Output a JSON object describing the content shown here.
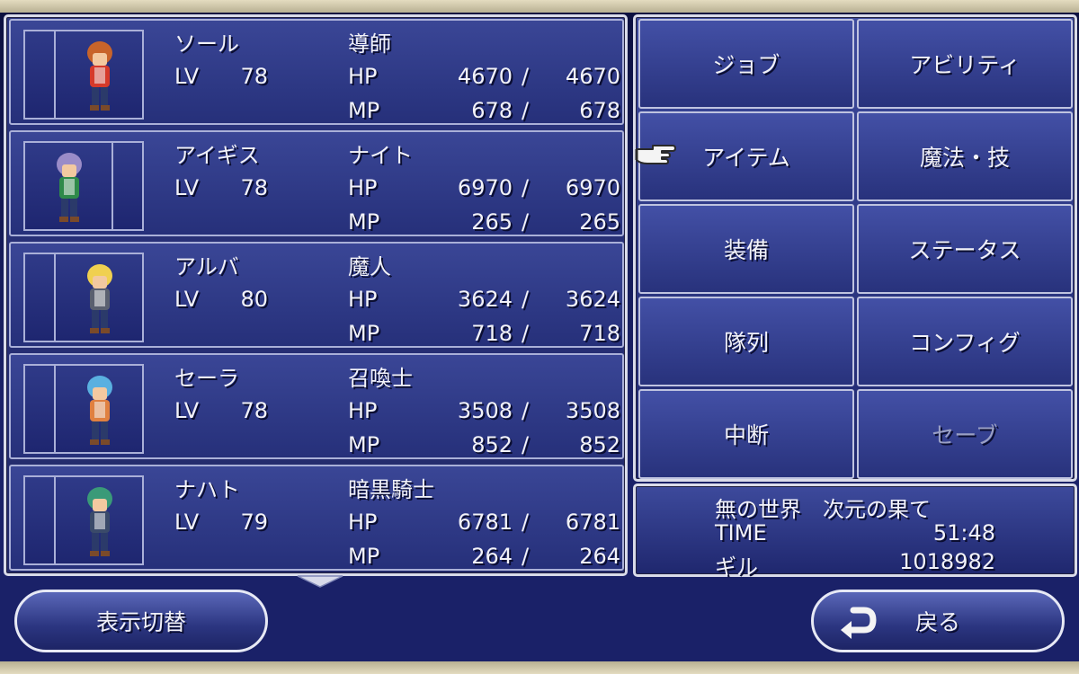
{
  "party": [
    {
      "name": "ソール",
      "job": "導師",
      "lv_label": "LV",
      "lv": "78",
      "hp_label": "HP",
      "hp_cur": "4670",
      "hp_max": "4670",
      "mp_label": "MP",
      "mp_cur": "678",
      "mp_max": "678",
      "hair": "#c8642a",
      "cloth": "#d63a2a"
    },
    {
      "name": "アイギス",
      "job": "ナイト",
      "lv_label": "LV",
      "lv": "78",
      "hp_label": "HP",
      "hp_cur": "6970",
      "hp_max": "6970",
      "mp_label": "MP",
      "mp_cur": "265",
      "mp_max": "265",
      "hair": "#9a8cc8",
      "cloth": "#2f8a4a"
    },
    {
      "name": "アルバ",
      "job": "魔人",
      "lv_label": "LV",
      "lv": "80",
      "hp_label": "HP",
      "hp_cur": "3624",
      "hp_max": "3624",
      "mp_label": "MP",
      "mp_cur": "718",
      "mp_max": "718",
      "hair": "#f0d050",
      "cloth": "#5a6070"
    },
    {
      "name": "セーラ",
      "job": "召喚士",
      "lv_label": "LV",
      "lv": "78",
      "hp_label": "HP",
      "hp_cur": "3508",
      "hp_max": "3508",
      "mp_label": "MP",
      "mp_cur": "852",
      "mp_max": "852",
      "hair": "#5ab0e0",
      "cloth": "#e08040"
    },
    {
      "name": "ナハト",
      "job": "暗黒騎士",
      "lv_label": "LV",
      "lv": "79",
      "hp_label": "HP",
      "hp_cur": "6781",
      "hp_max": "6781",
      "mp_label": "MP",
      "mp_cur": "264",
      "mp_max": "264",
      "hair": "#3a9a78",
      "cloth": "#3a4a6a"
    }
  ],
  "slash": "/",
  "menu": {
    "job": "ジョブ",
    "ability": "アビリティ",
    "item": "アイテム",
    "magic": "魔法・技",
    "equip": "装備",
    "status": "ステータス",
    "formation": "隊列",
    "config": "コンフィグ",
    "suspend": "中断",
    "save": "セーブ"
  },
  "info": {
    "location": "無の世界　次元の果て",
    "time_label": "TIME",
    "time": "51:48",
    "gil_label": "ギル",
    "gil": "1018982"
  },
  "buttons": {
    "toggle_display": "表示切替",
    "back": "戻る"
  },
  "icons": {
    "cursor": "pointing-hand-icon",
    "back": "return-arrow-icon",
    "scroll": "scroll-down-arrow-icon"
  }
}
